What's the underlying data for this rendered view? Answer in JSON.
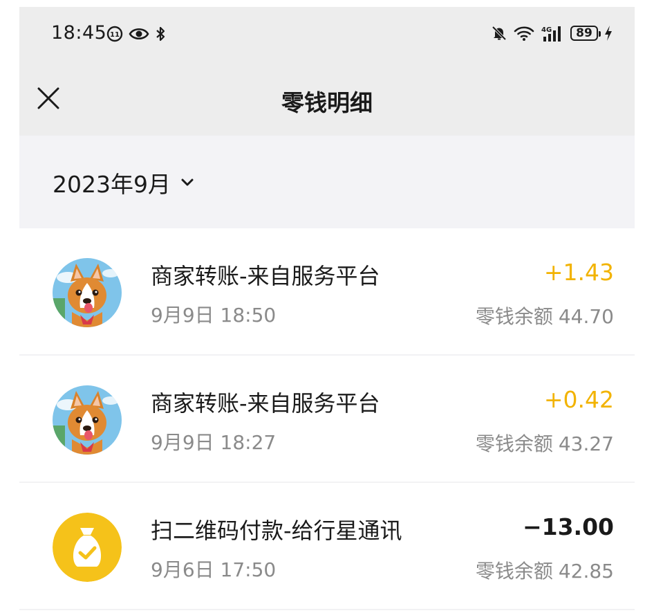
{
  "status_bar": {
    "time": "18:45",
    "battery": "89",
    "left_icons": [
      "notification-badge-icon",
      "eye-icon",
      "bluetooth-icon"
    ],
    "right_icons": [
      "mute-bell-icon",
      "wifi-icon",
      "4g-signal-icon",
      "battery-icon",
      "charging-icon"
    ]
  },
  "nav": {
    "title": "零钱明细",
    "close_icon": "close-icon"
  },
  "filter": {
    "month": "2023年9月",
    "dropdown_icon": "chevron-down-icon"
  },
  "transactions": [
    {
      "title": "商家转账-来自服务平台",
      "time": "9月9日 18:50",
      "amount": "+1.43",
      "balance_label": "零钱余额",
      "balance": "44.70",
      "avatar": "dog-avatar-icon",
      "amount_color": "#f2b300"
    },
    {
      "title": "商家转账-来自服务平台",
      "time": "9月9日 18:27",
      "amount": "+0.42",
      "balance_label": "零钱余额",
      "balance": "43.27",
      "avatar": "dog-avatar-icon",
      "amount_color": "#f2b300"
    },
    {
      "title": "扫二维码付款-给行星通讯",
      "time": "9月6日 17:50",
      "amount": "−13.00",
      "balance_label": "零钱余额",
      "balance": "42.85",
      "avatar": "money-bag-icon",
      "amount_color": "#1a1a1a"
    }
  ],
  "colors": {
    "header_bg": "#ededed",
    "filter_bg": "#f3f3f6",
    "income": "#f2b300",
    "expense": "#1a1a1a",
    "secondary_text": "#8a8a8a"
  }
}
